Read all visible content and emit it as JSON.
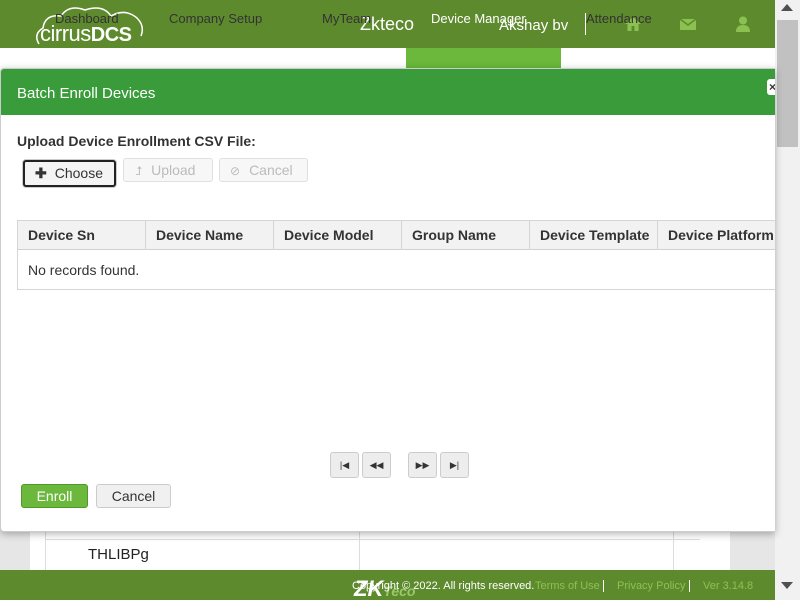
{
  "header": {
    "logo_light": "cirrus",
    "logo_bold": "DCS",
    "app_name": "Zkteco",
    "user_name": "Akshay bv",
    "icons": [
      "home-icon",
      "envelope-icon",
      "user-icon"
    ]
  },
  "nav": {
    "items": [
      "Dashboard",
      "Company Setup",
      "MyTeam",
      "Device Manager",
      "Attendance"
    ],
    "active": "Device Manager"
  },
  "background": {
    "row_cell": "THLIBPg"
  },
  "dialog": {
    "title": "Batch Enroll Devices",
    "close": "×",
    "upload_label": "Upload Device Enrollment CSV File:",
    "buttons": {
      "choose": "Choose",
      "upload": "Upload",
      "cancel": "Cancel"
    },
    "table": {
      "columns": [
        "Device Sn",
        "Device Name",
        "Device Model",
        "Group Name",
        "Device Template",
        "Device Platform"
      ],
      "empty_message": "No records found."
    },
    "footer_buttons": {
      "enroll": "Enroll",
      "cancel": "Cancel"
    }
  },
  "footer": {
    "logo": "ZK",
    "logo_sub": "Teco",
    "copyright": "Copyright © 2022. All rights reserved.",
    "links": [
      "Terms of Use",
      "Privacy Policy",
      "Ver 3.14.8"
    ]
  },
  "colors": {
    "header_green": "#5e8a2e",
    "dialog_header": "#3a9b3a",
    "accent_green": "#6bb83c"
  }
}
